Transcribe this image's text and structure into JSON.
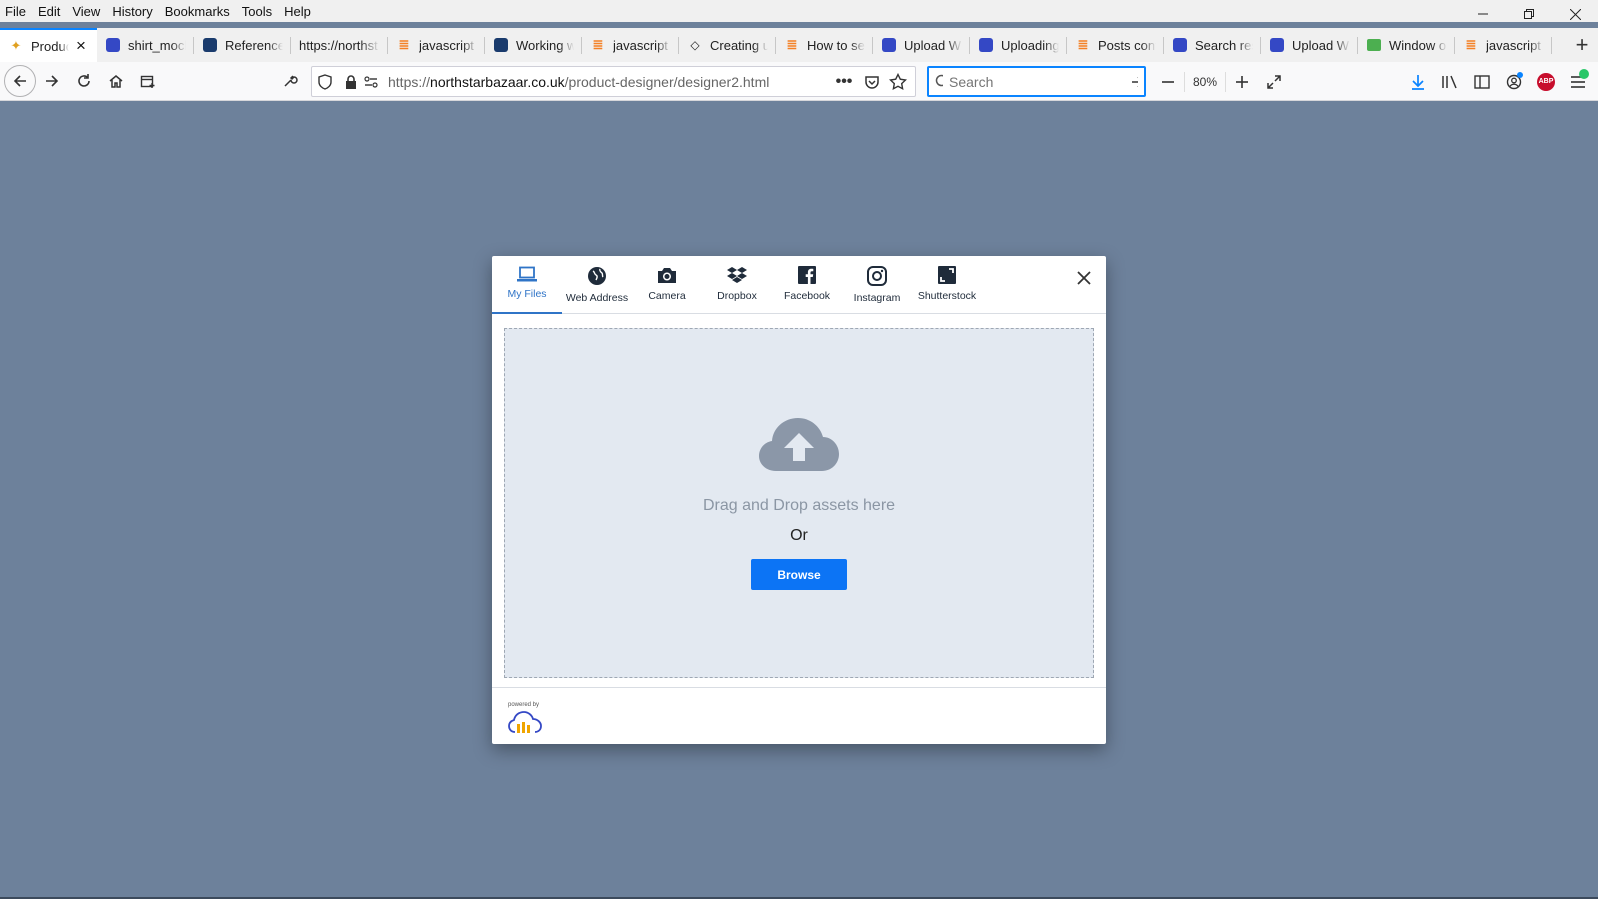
{
  "menubar": {
    "items": [
      "File",
      "Edit",
      "View",
      "History",
      "Bookmarks",
      "Tools",
      "Help"
    ]
  },
  "tabs": [
    {
      "title": "Produc",
      "favicon": "spark-icon",
      "active": true
    },
    {
      "title": "shirt_mock",
      "favicon": "cloudinary-icon"
    },
    {
      "title": "Reference",
      "favicon": "reference-icon"
    },
    {
      "title": "https://northst",
      "favicon": ""
    },
    {
      "title": "javascript",
      "favicon": "stackoverflow-icon"
    },
    {
      "title": "Working w",
      "favicon": "reference-icon"
    },
    {
      "title": "javascript",
      "favicon": "stackoverflow-icon"
    },
    {
      "title": "Creating u",
      "favicon": "codepen-icon"
    },
    {
      "title": "How to se",
      "favicon": "stackoverflow-icon"
    },
    {
      "title": "Upload Wi",
      "favicon": "cloudinary-icon"
    },
    {
      "title": "Uploading",
      "favicon": "cloudinary-icon"
    },
    {
      "title": "Posts cont",
      "favicon": "stackoverflow-icon"
    },
    {
      "title": "Search res",
      "favicon": "cloudinary-icon"
    },
    {
      "title": "Upload Wi",
      "favicon": "cloudinary-icon"
    },
    {
      "title": "Window o",
      "favicon": "window-icon"
    },
    {
      "title": "javascript",
      "favicon": "stackoverflow-icon"
    }
  ],
  "navbar": {
    "url_prefix": "https://",
    "url_domain": "northstarbazaar.co.uk",
    "url_path": "/product-designer/designer2.html",
    "search_placeholder": "Search",
    "zoom": "80%"
  },
  "modal": {
    "tabs": [
      {
        "label": "My Files",
        "icon": "laptop-icon",
        "active": true
      },
      {
        "label": "Web Address",
        "icon": "globe-icon"
      },
      {
        "label": "Camera",
        "icon": "camera-icon"
      },
      {
        "label": "Dropbox",
        "icon": "dropbox-icon"
      },
      {
        "label": "Facebook",
        "icon": "facebook-icon"
      },
      {
        "label": "Instagram",
        "icon": "instagram-icon"
      },
      {
        "label": "Shutterstock",
        "icon": "shutterstock-icon"
      }
    ],
    "drag_text": "Drag and Drop assets here",
    "or_text": "Or",
    "browse_label": "Browse",
    "powered_by": "powered by"
  },
  "colors": {
    "page_background": "#6d819b",
    "accent": "#0c74f5",
    "active_tab": "#2f74c7",
    "dropzone": "#e3e9f1"
  }
}
